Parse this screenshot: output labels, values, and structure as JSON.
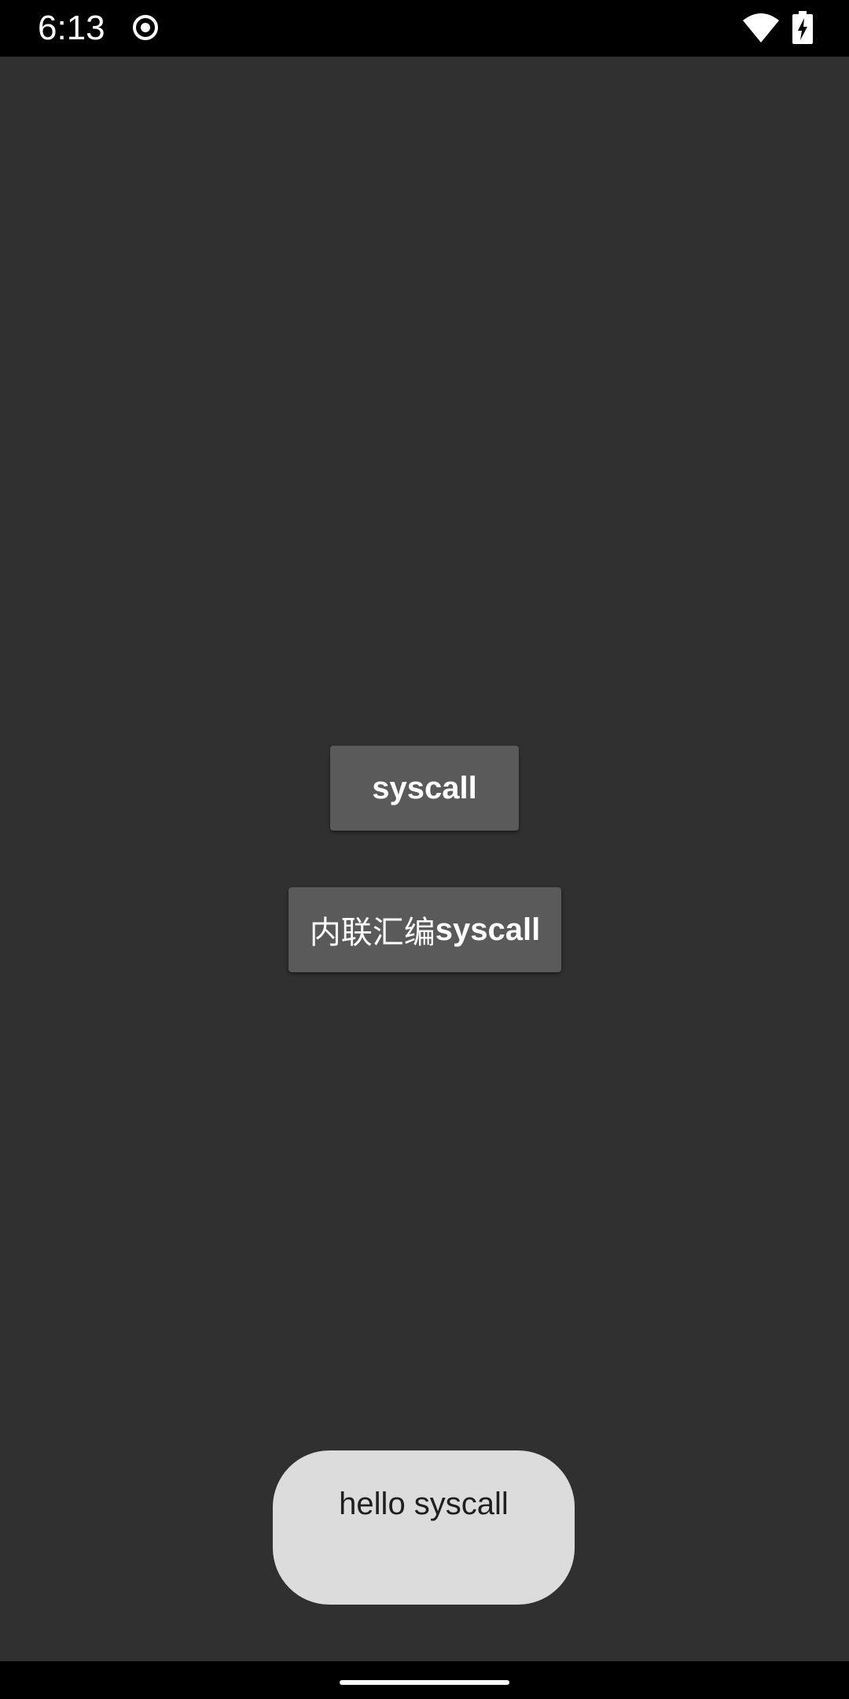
{
  "status_bar": {
    "time": "6:13",
    "icons": [
      "record-icon",
      "wifi-icon",
      "battery-charging-icon"
    ]
  },
  "main": {
    "buttons": [
      {
        "label": "syscall"
      },
      {
        "label_cjk": "内联汇编",
        "label_latin": "syscall"
      }
    ]
  },
  "toast": {
    "message": "hello syscall"
  },
  "colors": {
    "background": "#303030",
    "button": "#5a5a5b",
    "toast": "#dcdcdc",
    "bars": "#000000"
  }
}
